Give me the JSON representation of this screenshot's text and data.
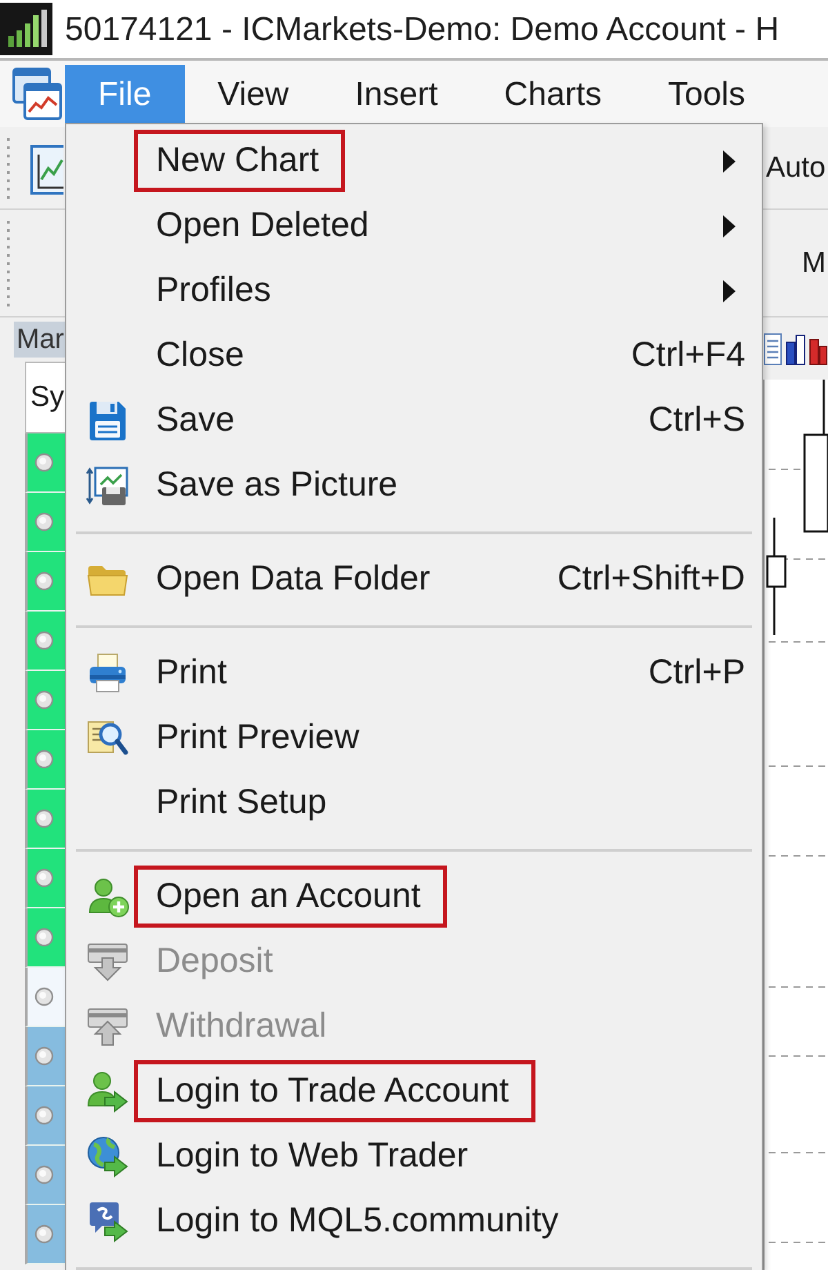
{
  "window": {
    "title": "50174121 - ICMarkets-Demo: Demo Account - H"
  },
  "menu_bar": [
    {
      "label": "File",
      "selected": true
    },
    {
      "label": "View",
      "selected": false
    },
    {
      "label": "Insert",
      "selected": false
    },
    {
      "label": "Charts",
      "selected": false
    },
    {
      "label": "Tools",
      "selected": false
    }
  ],
  "toolbars": [
    {
      "button": "Auto"
    },
    {
      "button": "M"
    }
  ],
  "market_watch": {
    "tab": "Mar",
    "header": "Sy",
    "rows": [
      {
        "color": "#22e27c"
      },
      {
        "color": "#22e27c"
      },
      {
        "color": "#22e27c"
      },
      {
        "color": "#22e27c"
      },
      {
        "color": "#22e27c"
      },
      {
        "color": "#22e27c"
      },
      {
        "color": "#22e27c"
      },
      {
        "color": "#22e27c"
      },
      {
        "color": "#22e27c"
      },
      {
        "color": "#f2f7fc"
      },
      {
        "color": "#86bcdf"
      },
      {
        "color": "#86bcdf"
      },
      {
        "color": "#86bcdf"
      },
      {
        "color": "#86bcdf"
      }
    ]
  },
  "file_menu": {
    "sections": [
      [
        {
          "label": "New Chart",
          "submenu": true,
          "disabled": false,
          "annotated": true
        },
        {
          "label": "Open Deleted",
          "submenu": true,
          "disabled": false,
          "annotated": false
        },
        {
          "label": "Profiles",
          "submenu": true,
          "disabled": false,
          "annotated": false
        },
        {
          "label": "Close",
          "shortcut": "Ctrl+F4",
          "submenu": false,
          "disabled": false,
          "annotated": false
        },
        {
          "label": "Save",
          "shortcut": "Ctrl+S",
          "submenu": false,
          "disabled": false,
          "annotated": false
        },
        {
          "label": "Save as Picture",
          "submenu": false,
          "disabled": false,
          "annotated": false
        }
      ],
      [
        {
          "label": "Open Data Folder",
          "shortcut": "Ctrl+Shift+D",
          "submenu": false,
          "disabled": false,
          "annotated": false
        }
      ],
      [
        {
          "label": "Print",
          "shortcut": "Ctrl+P",
          "submenu": false,
          "disabled": false,
          "annotated": false
        },
        {
          "label": "Print Preview",
          "submenu": false,
          "disabled": false,
          "annotated": false
        },
        {
          "label": "Print Setup",
          "submenu": false,
          "disabled": false,
          "annotated": false
        }
      ],
      [
        {
          "label": "Open an Account",
          "submenu": false,
          "disabled": false,
          "annotated": true
        },
        {
          "label": "Deposit",
          "submenu": false,
          "disabled": true,
          "annotated": false
        },
        {
          "label": "Withdrawal",
          "submenu": false,
          "disabled": true,
          "annotated": false
        },
        {
          "label": "Login to Trade Account",
          "submenu": false,
          "disabled": false,
          "annotated": true
        },
        {
          "label": "Login to Web Trader",
          "submenu": false,
          "disabled": false,
          "annotated": false
        },
        {
          "label": "Login to MQL5.community",
          "submenu": false,
          "disabled": false,
          "annotated": false
        }
      ]
    ]
  }
}
